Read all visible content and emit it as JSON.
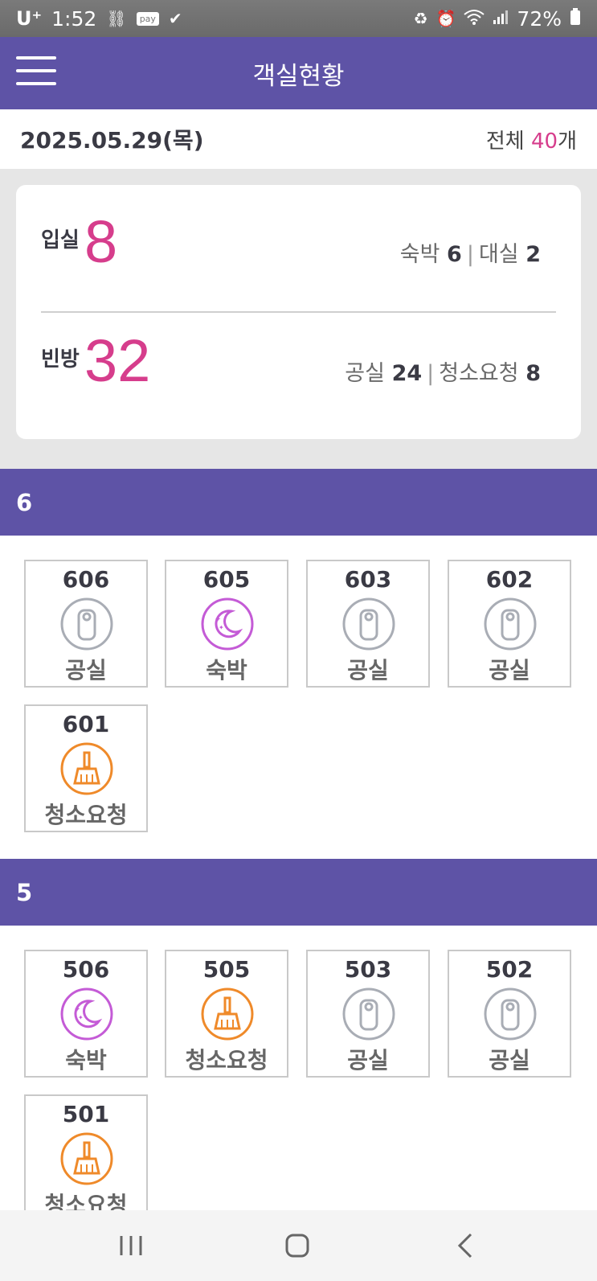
{
  "status_bar": {
    "carrier": "U⁺",
    "time": "1:52",
    "pay_label": "pay",
    "battery": "72%"
  },
  "app_bar": {
    "title": "객실현황",
    "menu_icon": "hamburger-menu-icon"
  },
  "date_row": {
    "date": "2025.05.29(목)",
    "total_prefix": "전체 ",
    "total_count": "40",
    "total_suffix": "개"
  },
  "summary": {
    "occupied": {
      "label": "입실",
      "count": "8",
      "detail": [
        {
          "label": "숙박 ",
          "value": "6"
        },
        {
          "label": "대실 ",
          "value": "2"
        }
      ]
    },
    "vacant": {
      "label": "빈방",
      "count": "32",
      "detail": [
        {
          "label": "공실 ",
          "value": "24"
        },
        {
          "label": "청소요청 ",
          "value": "8"
        }
      ]
    },
    "separator": "|"
  },
  "floors": [
    {
      "floor": "6",
      "rooms": [
        {
          "number": "606",
          "status": "공실",
          "icon": "door-hanger-icon"
        },
        {
          "number": "605",
          "status": "숙박",
          "icon": "moon-icon"
        },
        {
          "number": "603",
          "status": "공실",
          "icon": "door-hanger-icon"
        },
        {
          "number": "602",
          "status": "공실",
          "icon": "door-hanger-icon"
        },
        {
          "number": "601",
          "status": "청소요청",
          "icon": "broom-icon"
        }
      ]
    },
    {
      "floor": "5",
      "rooms": [
        {
          "number": "506",
          "status": "숙박",
          "icon": "moon-icon"
        },
        {
          "number": "505",
          "status": "청소요청",
          "icon": "broom-icon"
        },
        {
          "number": "503",
          "status": "공실",
          "icon": "door-hanger-icon"
        },
        {
          "number": "502",
          "status": "공실",
          "icon": "door-hanger-icon"
        },
        {
          "number": "501",
          "status": "청소요청",
          "icon": "broom-icon"
        }
      ]
    }
  ],
  "colors": {
    "brand": "#5e53a6",
    "accent": "#d63d8c",
    "vacant_icon": "#a9adb5",
    "stay_icon": "#c45bd6",
    "cleaning_icon": "#ef8a2a"
  }
}
